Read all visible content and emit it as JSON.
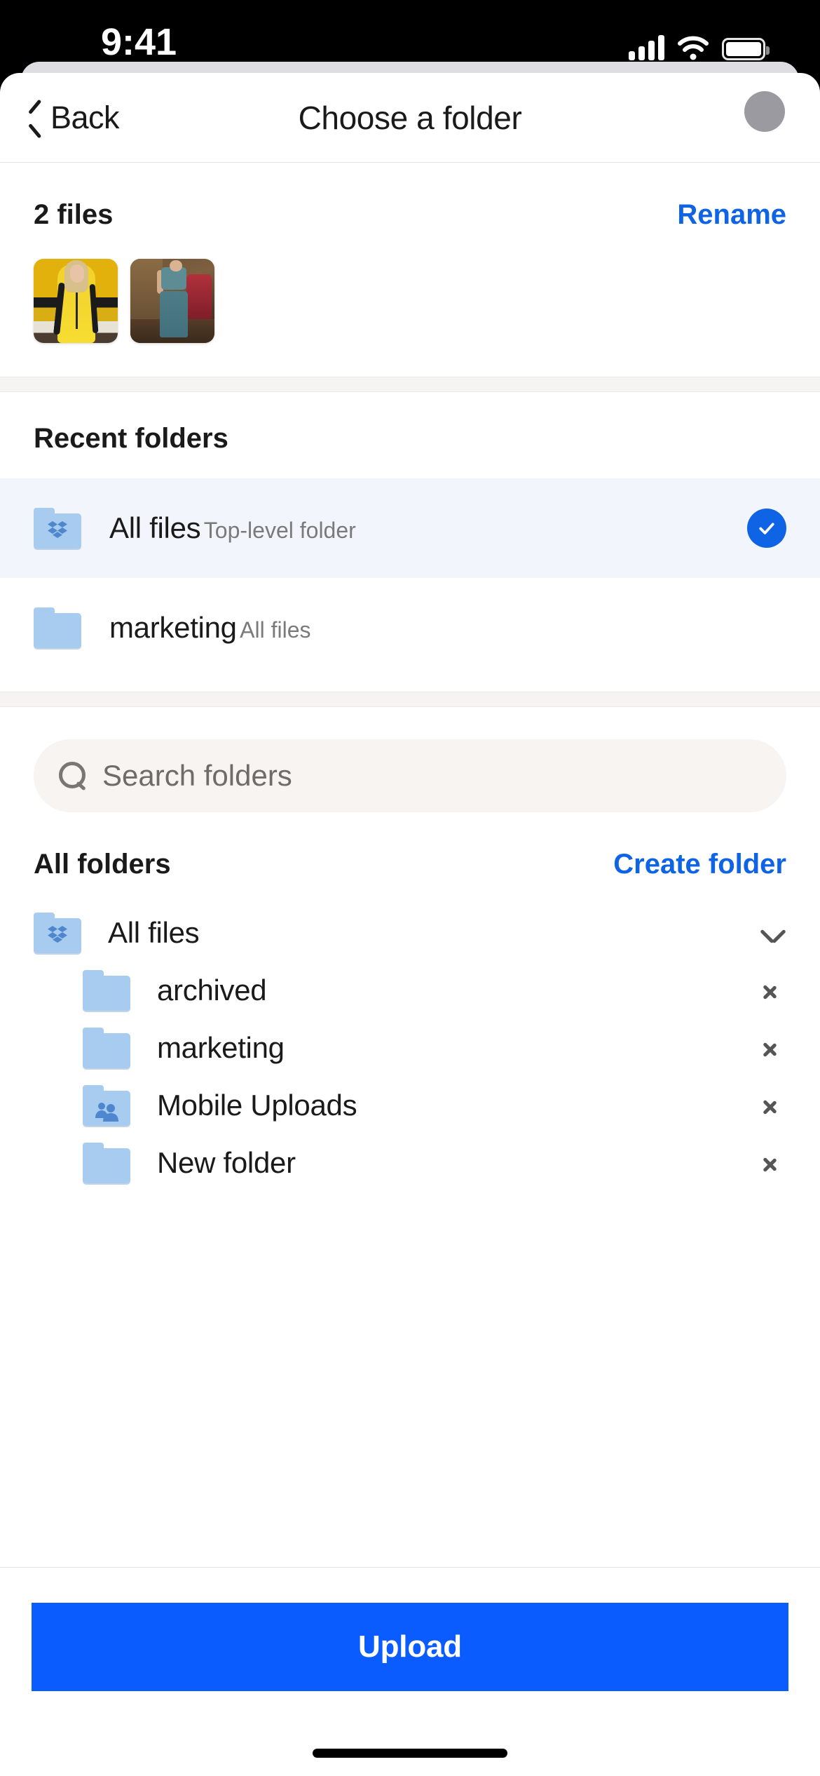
{
  "status_bar": {
    "time": "9:41",
    "cellular_icon": "cellular-signal-icon",
    "wifi_icon": "wifi-icon",
    "battery_icon": "battery-icon"
  },
  "header": {
    "back_label": "Back",
    "back_icon": "chevron-left-icon",
    "title": "Choose a folder",
    "avatar_icon": "user-avatar"
  },
  "files": {
    "count_label": "2 files",
    "rename_label": "Rename",
    "thumbnails": [
      {
        "name": "yellow-tracksuit-photo",
        "alt": "Woman in yellow tracksuit against yellow wall"
      },
      {
        "name": "teal-outfit-photo",
        "alt": "Person in teal outfit in vintage clothing store"
      }
    ]
  },
  "recent": {
    "title": "Recent folders",
    "items": [
      {
        "name": "All files",
        "subtitle": "Top-level folder",
        "icon": "dropbox-folder-icon",
        "selected": true,
        "check_icon": "check-circle-icon"
      },
      {
        "name": "marketing",
        "subtitle": "All files",
        "icon": "folder-icon",
        "selected": false
      }
    ]
  },
  "search": {
    "icon": "search-icon",
    "placeholder": "Search folders",
    "value": ""
  },
  "all_folders": {
    "title": "All folders",
    "create_label": "Create folder",
    "tree": [
      {
        "label": "All files",
        "icon": "dropbox-folder-icon",
        "chevron": "chevron-down-icon",
        "indent": false
      },
      {
        "label": "archived",
        "icon": "folder-icon",
        "chevron": "chevron-right-icon",
        "indent": true
      },
      {
        "label": "marketing",
        "icon": "folder-icon",
        "chevron": "chevron-right-icon",
        "indent": true
      },
      {
        "label": "Mobile Uploads",
        "icon": "shared-folder-icon",
        "chevron": "chevron-right-icon",
        "indent": true
      },
      {
        "label": "New folder",
        "icon": "folder-icon",
        "chevron": "chevron-right-icon",
        "indent": true
      }
    ]
  },
  "bottom": {
    "upload_label": "Upload",
    "home_indicator": "home-indicator"
  },
  "colors": {
    "accent_blue": "#0F63E5",
    "button_blue": "#0B5CFF",
    "folder_blue": "#A8CCF0",
    "selected_row_bg": "#F2F6FC",
    "search_bg": "#F7F4F1",
    "section_gap": "#F6F4F2"
  }
}
